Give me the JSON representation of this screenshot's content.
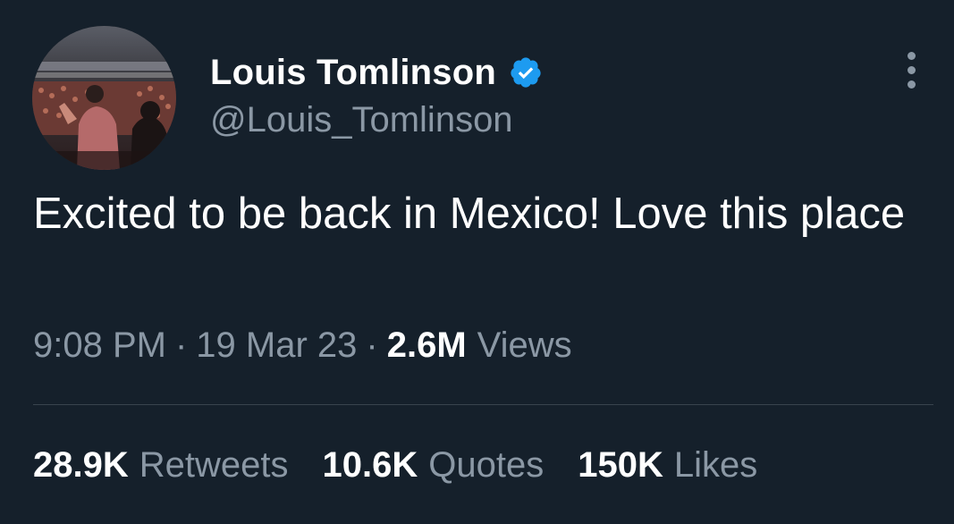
{
  "author": {
    "display_name": "Louis Tomlinson",
    "handle": "@Louis_Tomlinson",
    "verified": true,
    "verified_icon": "verified-badge-icon",
    "avatar_icon": "concert-crowd-photo"
  },
  "tweet": {
    "text": "Excited to be back in Mexico! Love this place",
    "time": "9:08 PM",
    "date": "19 Mar 23",
    "separator": "·",
    "views_count": "2.6M",
    "views_label": "Views"
  },
  "stats": {
    "retweets_count": "28.9K",
    "retweets_label": "Retweets",
    "quotes_count": "10.6K",
    "quotes_label": "Quotes",
    "likes_count": "150K",
    "likes_label": "Likes"
  },
  "menu": {
    "icon": "more-options-icon"
  },
  "colors": {
    "background": "#15202b",
    "primary_text": "#ffffff",
    "secondary_text": "#8b98a5",
    "verified_blue": "#1d9bf0",
    "divider": "#38444d"
  }
}
